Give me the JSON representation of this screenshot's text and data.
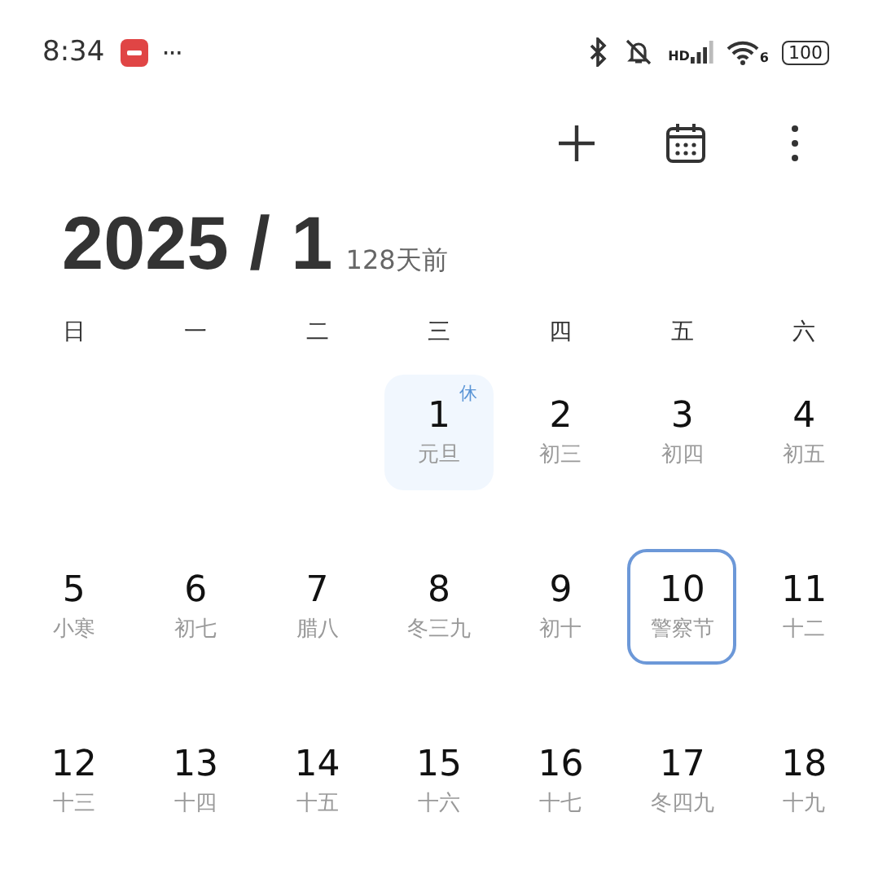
{
  "status_bar": {
    "time": "8:34",
    "more": "···",
    "network_label": "HD",
    "wifi_label": "6",
    "battery": "100"
  },
  "header": {
    "title": "2025 / 1",
    "relative": "128天前"
  },
  "weekdays": [
    "日",
    "一",
    "二",
    "三",
    "四",
    "五",
    "六"
  ],
  "weeks": [
    {
      "cells": [
        {
          "kind": "blank"
        },
        {
          "kind": "blank"
        },
        {
          "kind": "blank"
        },
        {
          "kind": "day",
          "day": "1",
          "sub": "元旦",
          "badge": "休",
          "holiday": true,
          "selected": false
        },
        {
          "kind": "day",
          "day": "2",
          "sub": "初三",
          "holiday": false,
          "selected": false
        },
        {
          "kind": "day",
          "day": "3",
          "sub": "初四",
          "holiday": false,
          "selected": false
        },
        {
          "kind": "day",
          "day": "4",
          "sub": "初五",
          "holiday": false,
          "selected": false
        }
      ]
    },
    {
      "cells": [
        {
          "kind": "day",
          "day": "5",
          "sub": "小寒",
          "holiday": false,
          "selected": false
        },
        {
          "kind": "day",
          "day": "6",
          "sub": "初七",
          "holiday": false,
          "selected": false
        },
        {
          "kind": "day",
          "day": "7",
          "sub": "腊八",
          "holiday": false,
          "selected": false
        },
        {
          "kind": "day",
          "day": "8",
          "sub": "冬三九",
          "holiday": false,
          "selected": false
        },
        {
          "kind": "day",
          "day": "9",
          "sub": "初十",
          "holiday": false,
          "selected": false
        },
        {
          "kind": "day",
          "day": "10",
          "sub": "警察节",
          "holiday": false,
          "selected": true
        },
        {
          "kind": "day",
          "day": "11",
          "sub": "十二",
          "holiday": false,
          "selected": false
        }
      ]
    },
    {
      "cells": [
        {
          "kind": "day",
          "day": "12",
          "sub": "十三",
          "holiday": false,
          "selected": false
        },
        {
          "kind": "day",
          "day": "13",
          "sub": "十四",
          "holiday": false,
          "selected": false
        },
        {
          "kind": "day",
          "day": "14",
          "sub": "十五",
          "holiday": false,
          "selected": false
        },
        {
          "kind": "day",
          "day": "15",
          "sub": "十六",
          "holiday": false,
          "selected": false
        },
        {
          "kind": "day",
          "day": "16",
          "sub": "十七",
          "holiday": false,
          "selected": false
        },
        {
          "kind": "day",
          "day": "17",
          "sub": "冬四九",
          "holiday": false,
          "selected": false
        },
        {
          "kind": "day",
          "day": "18",
          "sub": "十九",
          "holiday": false,
          "selected": false
        }
      ]
    }
  ]
}
